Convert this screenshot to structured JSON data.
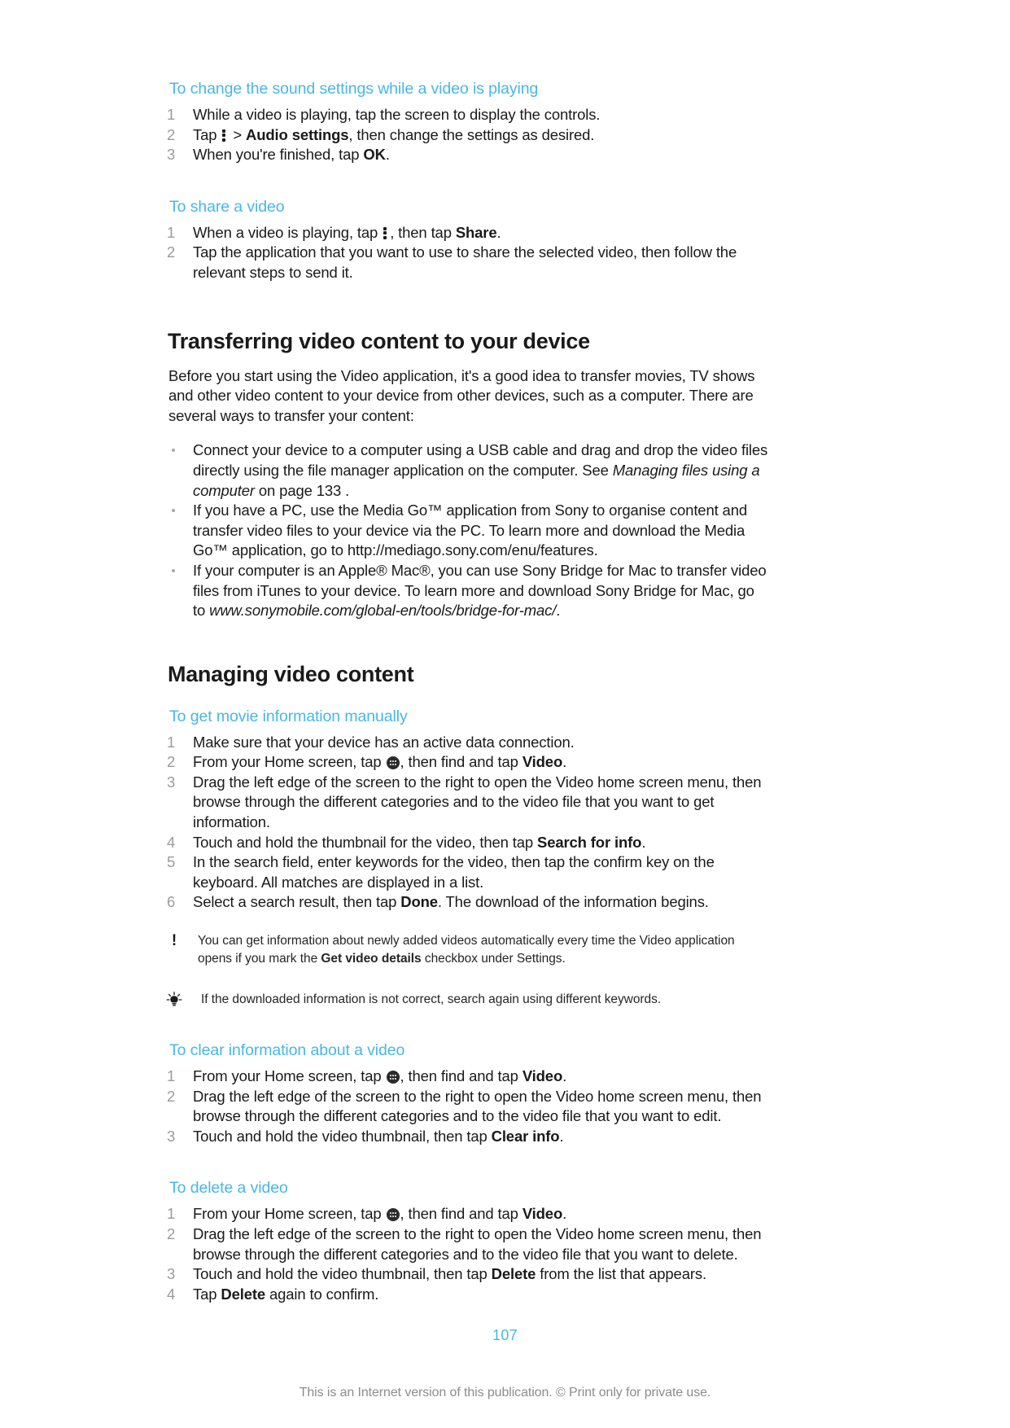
{
  "document": {
    "page_number": "107",
    "footer_note": "This is an Internet version of this publication. © Print only for private use.",
    "accent_color": "#49b7e4",
    "text_color": "#1a1a1a",
    "number_color": "#9b9b9b"
  },
  "procedures": {
    "sound_settings": {
      "heading": "To change the sound settings while a video is playing",
      "step1": "While a video is playing, tap the screen to display the controls.",
      "step2_pre": "Tap",
      "step2_mid": "> ",
      "step2_bold": "Audio settings",
      "step2_post": ", then change the settings as desired.",
      "step3_pre": "When you're finished, tap ",
      "step3_bold": "OK",
      "step3_post": "."
    },
    "share_video": {
      "heading": "To share a video",
      "step1_pre": "When a video is playing, tap",
      "step1_mid": ", then tap ",
      "step1_bold": "Share",
      "step1_post": ".",
      "step2": "Tap the application that you want to use to share the selected video, then follow the relevant steps to send it."
    },
    "movie_info": {
      "heading": "To get movie information manually",
      "step1": "Make sure that your device has an active data connection.",
      "step2_pre": "From your Home screen, tap ",
      "step2_mid": ", then find and tap ",
      "step2_bold": "Video",
      "step2_post": ".",
      "step3": "Drag the left edge of the screen to the right to open the Video home screen menu, then browse through the different categories and to the video file that you want to get information.",
      "step4_pre": "Touch and hold the thumbnail for the video, then tap ",
      "step4_bold": "Search for info",
      "step4_post": ".",
      "step5": "In the search field, enter keywords for the video, then tap the confirm key on the keyboard. All matches are displayed in a list.",
      "step6_pre": "Select a search result, then tap ",
      "step6_bold": "Done",
      "step6_post": ". The download of the information begins."
    },
    "clear_info": {
      "heading": "To clear information about a video",
      "step1_pre": "From your Home screen, tap ",
      "step1_mid": ", then find and tap ",
      "step1_bold": "Video",
      "step1_post": ".",
      "step2": "Drag the left edge of the screen to the right to open the Video home screen menu, then browse through the different categories and to the video file that you want to edit.",
      "step3_pre": "Touch and hold the video thumbnail, then tap ",
      "step3_bold": "Clear info",
      "step3_post": "."
    },
    "delete_video": {
      "heading": "To delete a video",
      "step1_pre": "From your Home screen, tap ",
      "step1_mid": ", then find and tap ",
      "step1_bold": "Video",
      "step1_post": ".",
      "step2": "Drag the left edge of the screen to the right to open the Video home screen menu, then browse through the different categories and to the video file that you want to delete.",
      "step3_pre": "Touch and hold the video thumbnail, then tap ",
      "step3_bold": "Delete",
      "step3_post": " from the list that appears.",
      "step4_pre": "Tap ",
      "step4_bold": "Delete",
      "step4_post": " again to confirm."
    }
  },
  "sections": {
    "transferring": {
      "heading": "Transferring video content to your device",
      "intro": "Before you start using the Video application, it's a good idea to transfer movies, TV shows and other video content to your device from other devices, such as a computer. There are several ways to transfer your content:",
      "bullet1_pre": "Connect your device to a computer using a USB cable and drag and drop the video files directly using the file manager application on the computer. See ",
      "bullet1_italic": "Managing files using a computer",
      "bullet1_post": " on page 133 .",
      "bullet2": "If you have a PC, use the Media Go™ application from Sony to organise content and transfer video files to your device via the PC. To learn more and download the Media Go™ application, go to http://mediago.sony.com/enu/features.",
      "bullet3_pre": "If your computer is an Apple® Mac®, you can use Sony Bridge for Mac to transfer video files from iTunes to your device. To learn more and download Sony Bridge for Mac, go to ",
      "bullet3_italic": "www.sonymobile.com/global-en/tools/bridge-for-mac/",
      "bullet3_post": "."
    },
    "managing": {
      "heading": "Managing video content"
    }
  },
  "callouts": {
    "note": {
      "icon": "exclamation-note-icon",
      "text_pre": "You can get information about newly added videos automatically every time the Video application opens if you mark the ",
      "text_bold": "Get video details",
      "text_post": " checkbox under Settings."
    },
    "tip": {
      "icon": "lightbulb-tip-icon",
      "text": "If the downloaded information is not correct, search again using different keywords."
    }
  }
}
